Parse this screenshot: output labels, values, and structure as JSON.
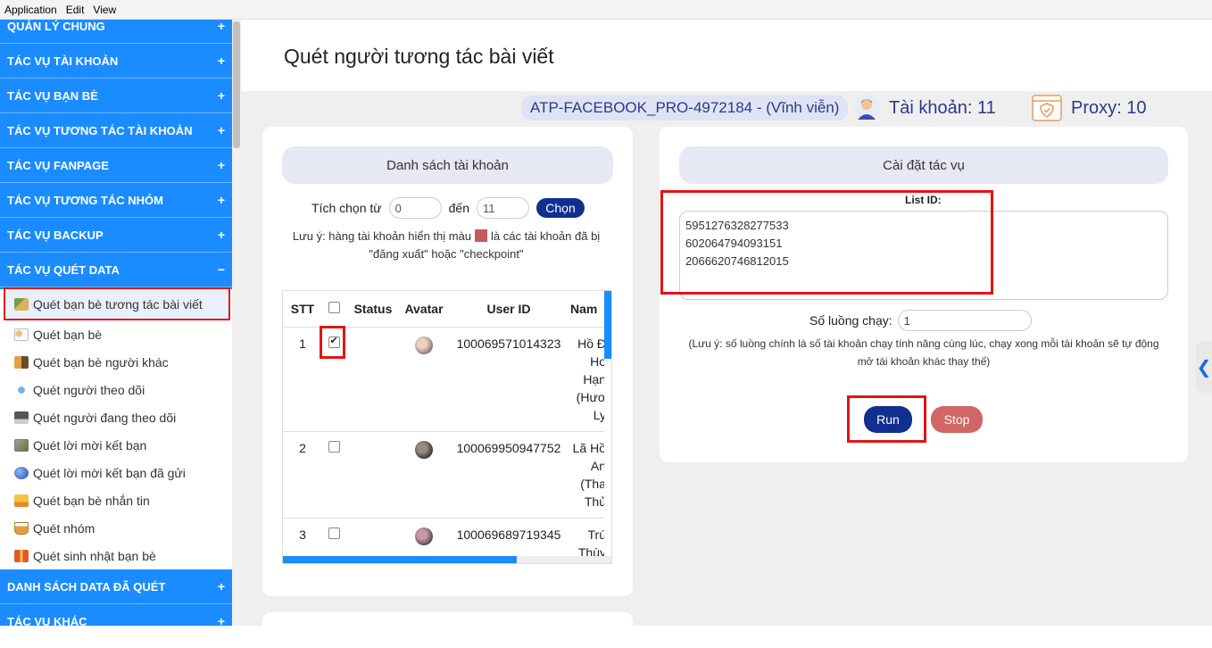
{
  "menubar": {
    "items": [
      "Application",
      "Edit",
      "View"
    ]
  },
  "sidebar": {
    "categories_top": [
      {
        "label": "QUẢN LÝ CHUNG",
        "sign": "+"
      },
      {
        "label": "TÁC VỤ TÀI KHOẢN",
        "sign": "+"
      },
      {
        "label": "TÁC VỤ BẠN BÈ",
        "sign": "+"
      },
      {
        "label": "TÁC VỤ TƯƠNG TÁC TÀI KHOẢN",
        "sign": "+"
      },
      {
        "label": "TÁC VỤ FANPAGE",
        "sign": "+"
      },
      {
        "label": "TÁC VỤ TƯƠNG TÁC NHÓM",
        "sign": "+"
      },
      {
        "label": "TÁC VỤ BACKUP",
        "sign": "+"
      },
      {
        "label": "TÁC VỤ QUÉT DATA",
        "sign": "−"
      }
    ],
    "sub_items": [
      {
        "label": "Quét bạn bè tương tác bài viết",
        "icon": "map-icon"
      },
      {
        "label": "Quét bạn bè",
        "icon": "people-icon"
      },
      {
        "label": "Quét bạn bè người khác",
        "icon": "group-icon"
      },
      {
        "label": "Quét người theo dõi",
        "icon": "network-icon"
      },
      {
        "label": "Quét người đang theo dõi",
        "icon": "monitor-icon"
      },
      {
        "label": "Quét lời mời kết bạn",
        "icon": "picture-icon"
      },
      {
        "label": "Quét lời mời kết bạn đã gửi",
        "icon": "globe-icon"
      },
      {
        "label": "Quét bạn bè nhắn tin",
        "icon": "chat-icon"
      },
      {
        "label": "Quét nhóm",
        "icon": "cup-icon"
      },
      {
        "label": "Quét sinh nhật bạn bè",
        "icon": "gift-icon"
      }
    ],
    "categories_bottom": [
      {
        "label": "DANH SÁCH DATA ĐÃ QUÉT",
        "sign": "+"
      },
      {
        "label": "TÁC VỤ KHÁC",
        "sign": "+"
      }
    ]
  },
  "header": {
    "title": "Quét người tương tác bài viết",
    "license": "ATP-FACEBOOK_PRO-4972184 - (Vĩnh viễn)",
    "accounts": "Tài khoản: 11",
    "proxy": "Proxy: 10"
  },
  "accounts_panel": {
    "title": "Danh sách tài khoản",
    "select_from_label": "Tích chọn từ",
    "from_value": "0",
    "to_label": "đến",
    "to_value": "11",
    "choose_button": "Chọn",
    "note_before": "Lưu ý: hàng tài khoản hiển thị màu",
    "note_after": "là các tài khoản đã bị",
    "note_line2": "\"đăng xuất\" hoặc \"checkpoint\"",
    "columns": [
      "STT",
      "",
      "Status",
      "Avatar",
      "User ID",
      "Nam"
    ],
    "rows": [
      {
        "stt": "1",
        "checked": true,
        "status": "",
        "user_id": "100069571014323",
        "name_lines": [
          "Hồ Đ",
          "Ho",
          "Hạn",
          "(Hươ",
          "Ly"
        ]
      },
      {
        "stt": "2",
        "checked": false,
        "status": "",
        "user_id": "100069950947752",
        "name_lines": [
          "Lã Hồ",
          "An",
          "(Tha",
          "Thủ"
        ]
      },
      {
        "stt": "3",
        "checked": false,
        "status": "",
        "user_id": "100069689719345",
        "name_lines": [
          "Trú",
          "Thùy"
        ]
      }
    ]
  },
  "settings_panel": {
    "title": "Cài đặt tác vụ",
    "list_id_label": "List ID:",
    "list_ids": [
      "5951276328277533",
      "602064794093151",
      "2066620746812015"
    ],
    "threads_label": "Số luồng chạy:",
    "threads_value": "1",
    "note": "(Lưu ý: số luồng chính là số tài khoản chạy tính năng cùng lúc, chạy xong mỗi tài khoản sẽ tự động mở tài khoản khác thay thế)",
    "run_label": "Run",
    "stop_label": "Stop"
  },
  "colors": {
    "sidebar": "#1a8cff",
    "accent": "#102f8e",
    "stop": "#d06666",
    "highlight_box": "#e31414"
  }
}
